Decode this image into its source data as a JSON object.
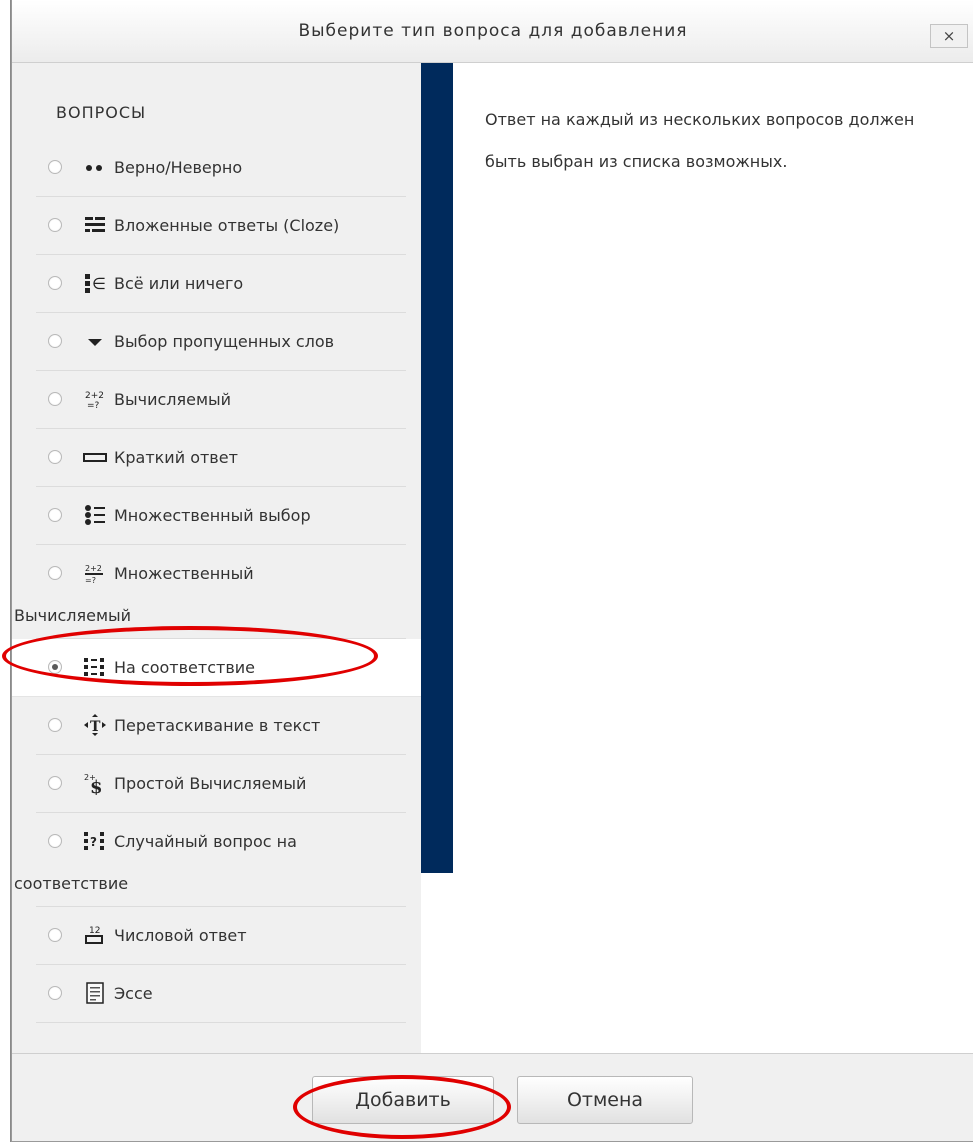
{
  "dialog": {
    "title": "Выберите тип вопроса для добавления",
    "close_label": "×"
  },
  "options_panel": {
    "section_label": "ВОПРОСЫ",
    "items": [
      {
        "label": "Верно/Неверно",
        "icon": "true-false-icon",
        "selected": false
      },
      {
        "label": "Вложенные ответы (Cloze)",
        "icon": "cloze-icon",
        "selected": false
      },
      {
        "label": "Всё или ничего",
        "icon": "all-or-nothing-icon",
        "selected": false
      },
      {
        "label": "Выбор пропущенных слов",
        "icon": "dropdown-select-icon",
        "selected": false
      },
      {
        "label": "Вычисляемый",
        "icon": "calculated-icon",
        "selected": false
      },
      {
        "label": "Краткий ответ",
        "icon": "short-answer-icon",
        "selected": false
      },
      {
        "label": "Множественный выбор",
        "icon": "multichoice-icon",
        "selected": false
      },
      {
        "label": "Множественный",
        "label_cont": "Вычисляемый",
        "icon": "calculated-multi-icon",
        "selected": false
      },
      {
        "label": "На соответствие",
        "icon": "matching-icon",
        "selected": true
      },
      {
        "label": "Перетаскивание в текст",
        "icon": "drag-to-text-icon",
        "selected": false
      },
      {
        "label": "Простой Вычисляемый",
        "icon": "simple-calculated-icon",
        "selected": false
      },
      {
        "label": "Случайный вопрос на",
        "label_cont": "соответствие",
        "icon": "random-matching-icon",
        "selected": false
      },
      {
        "label": "Числовой ответ",
        "icon": "numerical-icon",
        "selected": false
      },
      {
        "label": "Эссе",
        "icon": "essay-icon",
        "selected": false
      }
    ]
  },
  "description": "Ответ на каждый из нескольких вопросов должен быть выбран из списка возможных.",
  "footer": {
    "add_label": "Добавить",
    "cancel_label": "Отмена"
  },
  "colors": {
    "divider": "#002a5c",
    "annotation": "#e00000",
    "panel_bg": "#f0f0f0"
  }
}
